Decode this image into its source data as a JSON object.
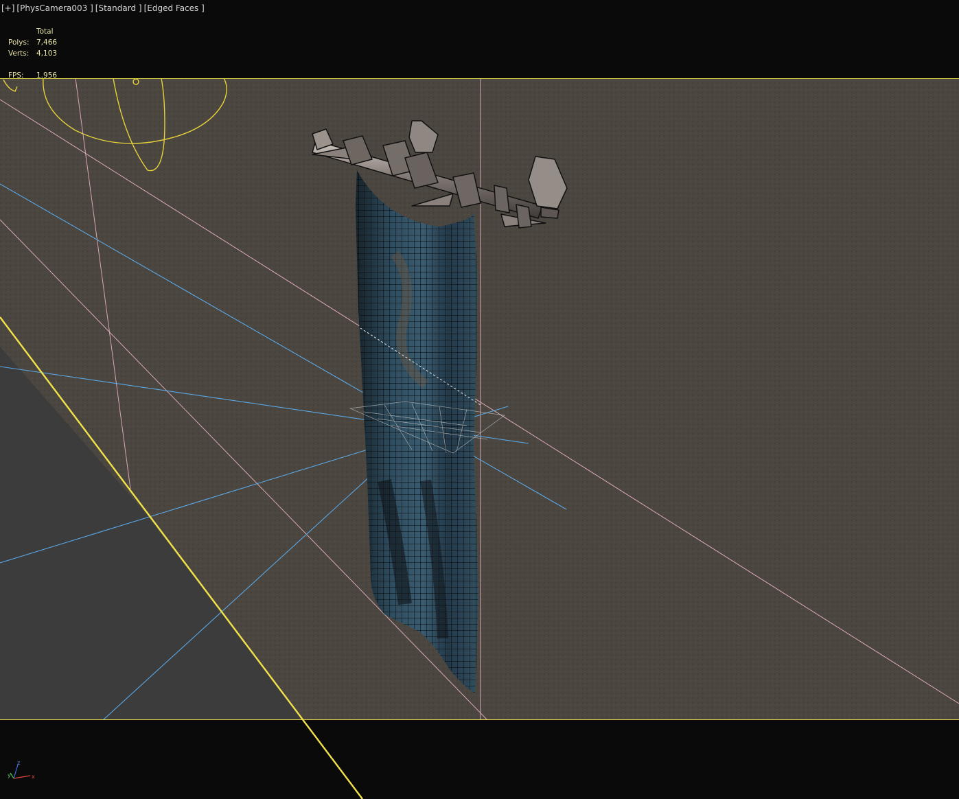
{
  "viewport": {
    "menu_plus": "[+]",
    "camera": "[PhysCamera003 ]",
    "shading": "[Standard ]",
    "display_mode": "[Edged Faces ]"
  },
  "stats": {
    "header": "Total",
    "polys_label": "Polys:",
    "polys_value": "7,466",
    "verts_label": "Verts:",
    "verts_value": "4,103",
    "fps_label": "FPS:",
    "fps_value": "1.956"
  },
  "axis": {
    "x": "x",
    "y": "y",
    "z": "z"
  },
  "colors": {
    "background": "#0a0a0a",
    "safe_frame": "#e8d94a",
    "wall": "#4a463f",
    "floor": "#3b3b3b",
    "blue_lines": "#5aa7e6",
    "pink_lines": "#d9a8b4",
    "light_gizmo": "#e6d23a",
    "stats_text": "#e7e3a6"
  }
}
